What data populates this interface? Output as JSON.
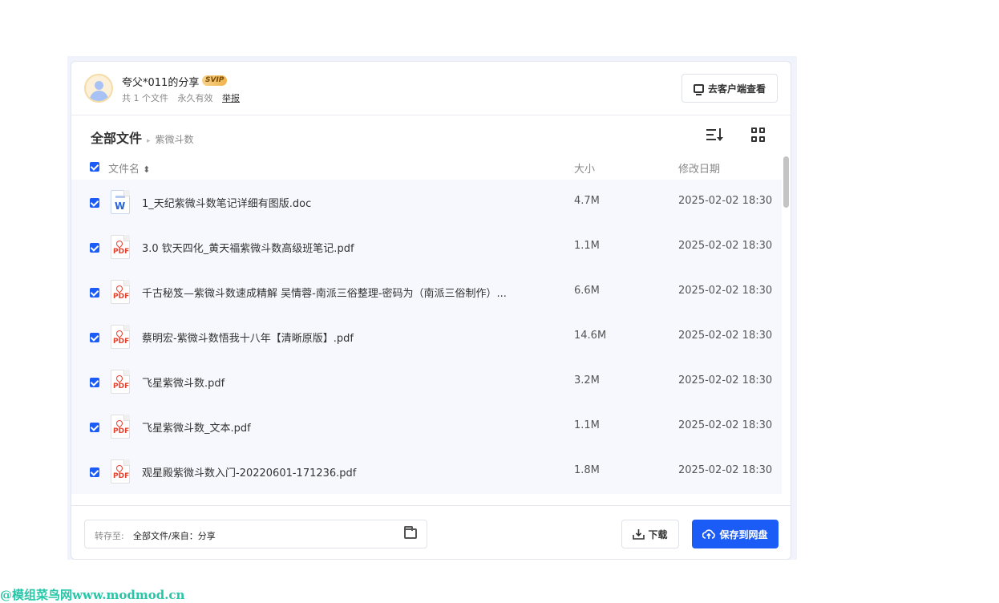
{
  "share": {
    "title": "夸父*011的分享",
    "badge": "SVIP",
    "file_count": "共 1 个文件",
    "validity": "永久有效",
    "report": "举报",
    "client_button": "去客户端查看"
  },
  "breadcrumb": {
    "root": "全部文件",
    "separator": "▸",
    "current": "紫微斗数"
  },
  "columns": {
    "name": "文件名",
    "sort_glyph": "⬍",
    "size": "大小",
    "date": "修改日期"
  },
  "files": [
    {
      "type": "doc",
      "icon_label": "W",
      "name": "1_天纪紫微斗数笔记详细有图版.doc",
      "size": "4.7M",
      "date": "2025-02-02 18:30"
    },
    {
      "type": "pdf",
      "icon_label": "PDF",
      "name": "3.0 钦天四化_黄天福紫微斗数高级班笔记.pdf",
      "size": "1.1M",
      "date": "2025-02-02 18:30"
    },
    {
      "type": "pdf",
      "icon_label": "PDF",
      "name": "千古秘笈—紫微斗数速成精解 吴情蓉-南派三俗整理-密码为（南派三俗制作）...",
      "size": "6.6M",
      "date": "2025-02-02 18:30"
    },
    {
      "type": "pdf",
      "icon_label": "PDF",
      "name": "蔡明宏-紫微斗数悟我十八年【清晰原版】.pdf",
      "size": "14.6M",
      "date": "2025-02-02 18:30"
    },
    {
      "type": "pdf",
      "icon_label": "PDF",
      "name": "飞星紫微斗数.pdf",
      "size": "3.2M",
      "date": "2025-02-02 18:30"
    },
    {
      "type": "pdf",
      "icon_label": "PDF",
      "name": "飞星紫微斗数_文本.pdf",
      "size": "1.1M",
      "date": "2025-02-02 18:30"
    },
    {
      "type": "pdf",
      "icon_label": "PDF",
      "name": "观星殿紫微斗数入门-20220601-171236.pdf",
      "size": "1.8M",
      "date": "2025-02-02 18:30"
    }
  ],
  "footer": {
    "save_to_label": "转存至:",
    "save_to_value": "全部文件/来自：分享",
    "download_button": "下载",
    "save_button": "保存到网盘"
  },
  "watermark": "@模组菜鸟网www.modmod.cn",
  "colors": {
    "accent": "#1c5cf6",
    "pdf": "#e5412c",
    "doc": "#2a64d6",
    "watermark": "#26c6a8"
  }
}
